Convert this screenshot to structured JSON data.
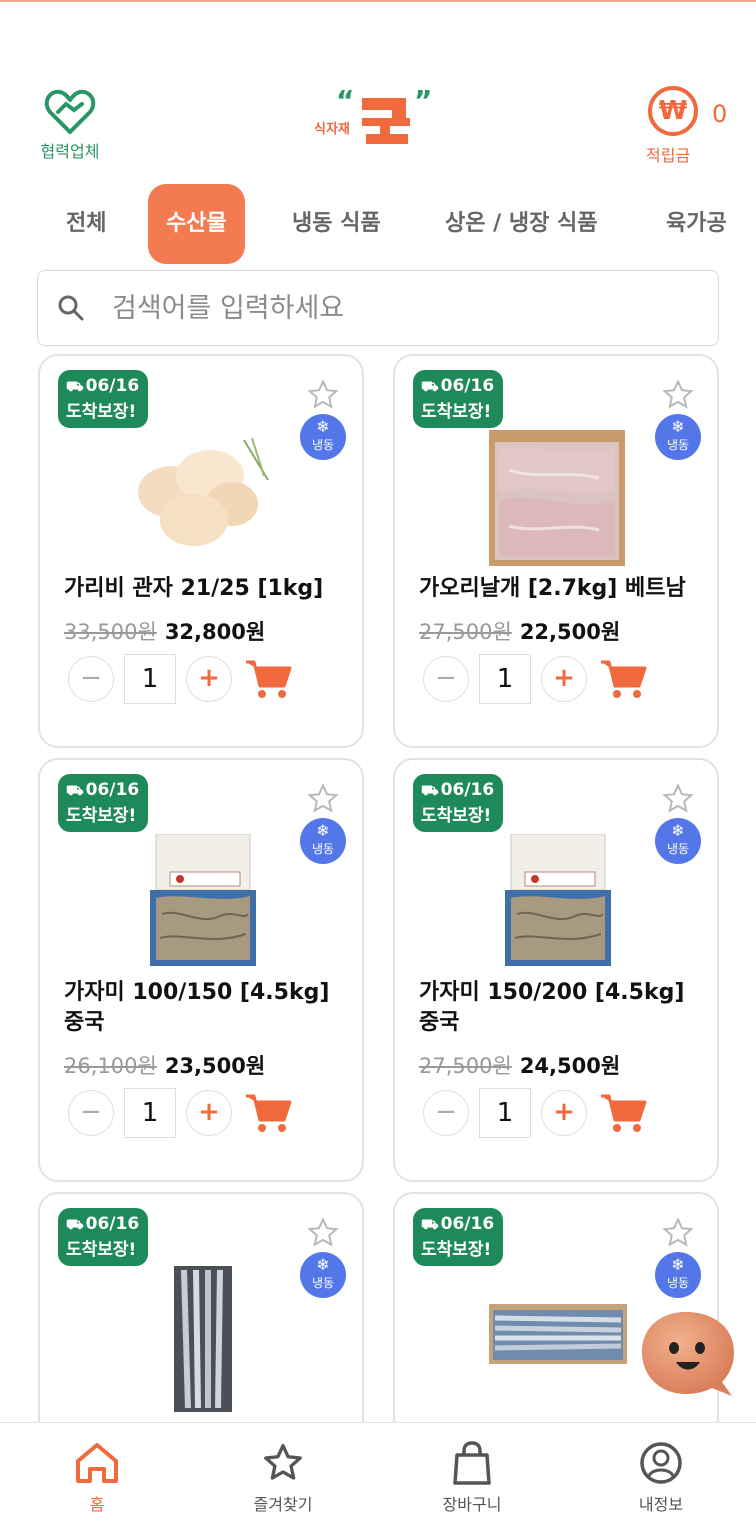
{
  "header": {
    "partner_label": "협력업체",
    "logo_text": "식자재",
    "points_symbol": "₩",
    "points_label": "적립금",
    "points_value": "0"
  },
  "tabs": [
    {
      "label": "전체",
      "active": false
    },
    {
      "label": "수산물",
      "active": true
    },
    {
      "label": "냉동 식품",
      "active": false
    },
    {
      "label": "상온 / 냉장 식품",
      "active": false
    },
    {
      "label": "육가공",
      "active": false
    }
  ],
  "search": {
    "placeholder": "검색어를 입력하세요"
  },
  "products": [
    {
      "badge_date": "06/16",
      "badge_text": "도착보장!",
      "frozen_label": "냉동",
      "name": "가리비 관자 21/25 [1kg]",
      "old_price": "33,500원",
      "price": "32,800원",
      "qty": "1"
    },
    {
      "badge_date": "06/16",
      "badge_text": "도착보장!",
      "frozen_label": "냉동",
      "name": "가오리날개 [2.7kg] 베트남",
      "old_price": "27,500원",
      "price": "22,500원",
      "qty": "1"
    },
    {
      "badge_date": "06/16",
      "badge_text": "도착보장!",
      "frozen_label": "냉동",
      "name": "가자미 100/150 [4.5kg] 중국",
      "old_price": "26,100원",
      "price": "23,500원",
      "qty": "1"
    },
    {
      "badge_date": "06/16",
      "badge_text": "도착보장!",
      "frozen_label": "냉동",
      "name": "가자미 150/200 [4.5kg] 중국",
      "old_price": "27,500원",
      "price": "24,500원",
      "qty": "1"
    },
    {
      "badge_date": "06/16",
      "badge_text": "도착보장!",
      "frozen_label": "냉동"
    },
    {
      "badge_date": "06/16",
      "badge_text": "도착보장!",
      "frozen_label": "냉동"
    }
  ],
  "bottom_nav": [
    {
      "label": "홈",
      "icon": "home-icon",
      "active": true
    },
    {
      "label": "즐겨찾기",
      "icon": "star-icon",
      "active": false
    },
    {
      "label": "장바구니",
      "icon": "shopping-bag-icon",
      "active": false
    },
    {
      "label": "내정보",
      "icon": "user-icon",
      "active": false
    }
  ],
  "colors": {
    "accent": "#f06a3e",
    "badge_green": "#1e8a5a",
    "frozen_blue": "#5377e8",
    "partner_green": "#2a9566"
  }
}
